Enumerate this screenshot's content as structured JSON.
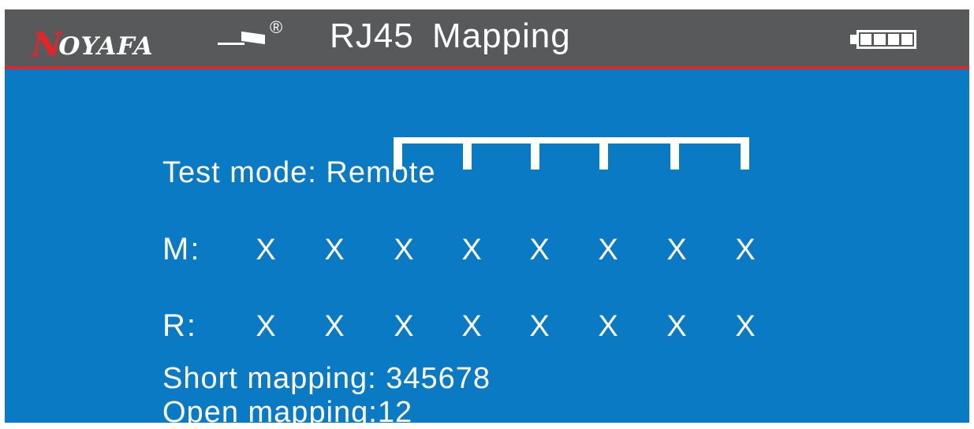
{
  "header": {
    "brand_first": "N",
    "brand_rest": "OYAFA",
    "registered": "®",
    "title": "RJ45 Mapping",
    "battery_icon": "battery-full-icon",
    "battery_cells": 4
  },
  "colors": {
    "header_bg": "#58595b",
    "accent_line": "#e0262b",
    "screen_bg": "#0a7ac4",
    "text": "#ffffff"
  },
  "test_mode": "Test mode: Remote",
  "main_row": {
    "label": "M:",
    "pins": [
      "X",
      "X",
      "X",
      "X",
      "X",
      "X",
      "X",
      "X"
    ]
  },
  "remote_row": {
    "label": "R:",
    "pins": [
      "X",
      "X",
      "X",
      "X",
      "X",
      "X",
      "X",
      "X"
    ]
  },
  "short_mapping": "Short mapping: 345678",
  "open_mapping": "Open mapping:12"
}
